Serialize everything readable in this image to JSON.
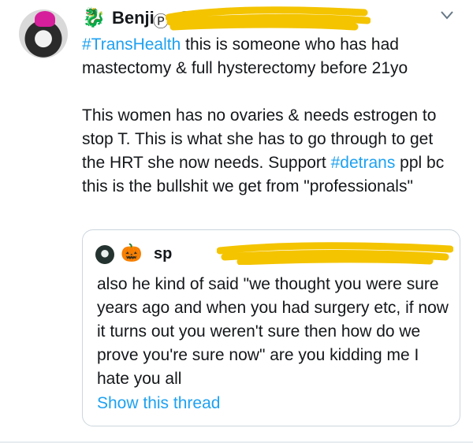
{
  "tweet": {
    "author_emoji": "🐉",
    "author_name": "Benji",
    "author_symbol": "Ⓟ",
    "author_handle": "@",
    "text_segments": [
      {
        "text": "#TransHealth",
        "type": "hashtag"
      },
      {
        "text": " this is someone who has had mastectomy & full hysterectomy before 21yo\n\nThis women has no ovaries & needs estrogen to stop T. This is what she has to go through to get the HRT she now needs. Support ",
        "type": "text"
      },
      {
        "text": "#detrans",
        "type": "hashtag"
      },
      {
        "text": " ppl bc this is the bullshit we get from \"professionals\"",
        "type": "text"
      }
    ]
  },
  "quoted_tweet": {
    "emoji": "🎃",
    "author_name": "sp",
    "text": "also he kind of said \"we thought you were sure years ago and when you had surgery etc, if now it turns out you weren't sure then how do we prove you're sure now\" are you kidding me I hate you all",
    "show_thread_label": "Show this thread"
  },
  "colors": {
    "link": "#1da1f2",
    "text": "#14171a",
    "muted": "#657786",
    "scribble": "#f4c400",
    "border": "#ccd6dd"
  },
  "icons": {
    "chevron": "chevron-down-icon"
  }
}
